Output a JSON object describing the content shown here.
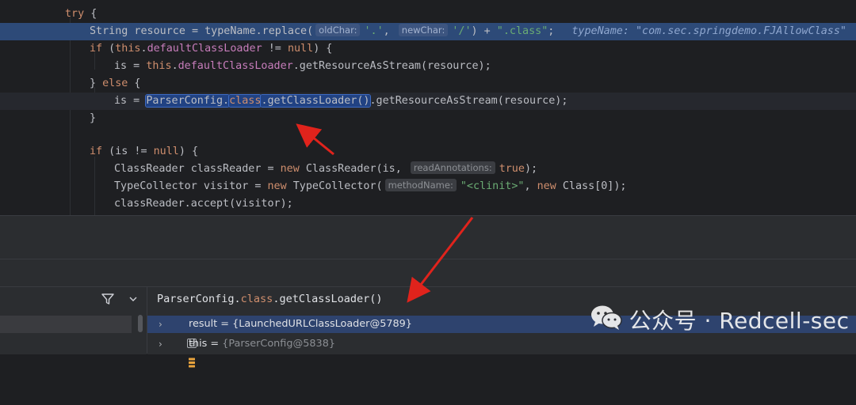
{
  "code_lines": [
    [
      {
        "t": "try",
        "c": "kw"
      },
      {
        "t": " {"
      }
    ],
    [
      {
        "t": "String resource = typeName.replace("
      },
      {
        "hint": "oldChar:"
      },
      {
        "t": "'.'",
        "c": "str"
      },
      {
        "t": ", "
      },
      {
        "hint": "newChar:"
      },
      {
        "t": "'/'",
        "c": "str"
      },
      {
        "t": ") + "
      },
      {
        "t": "\".class\"",
        "c": "str"
      },
      {
        "t": ";"
      },
      {
        "t": "typeName: \"com.sec.springdemo.FJAllowClass\"",
        "c": "inline"
      }
    ],
    [
      {
        "t": "if",
        "c": "kw"
      },
      {
        "t": " ("
      },
      {
        "t": "this",
        "c": "kw"
      },
      {
        "t": "."
      },
      {
        "t": "defaultClassLoader",
        "c": "fld"
      },
      {
        "t": " != "
      },
      {
        "t": "null",
        "c": "kw"
      },
      {
        "t": ") {"
      }
    ],
    [
      {
        "t": "is = "
      },
      {
        "t": "this",
        "c": "kw"
      },
      {
        "t": "."
      },
      {
        "t": "defaultClassLoader",
        "c": "fld"
      },
      {
        "t": ".getResourceAsStream(resource);"
      }
    ],
    [
      {
        "t": "} "
      },
      {
        "t": "else",
        "c": "kw"
      },
      {
        "t": " {"
      }
    ],
    [
      {
        "t": "is = "
      },
      {
        "t": "ParserConfig.",
        "c": "sel"
      },
      {
        "t": "class",
        "c": "sel kw"
      },
      {
        "t": ".getClassLoader()",
        "c": "sel"
      },
      {
        "t": ".getResourceAsStream(resource);"
      }
    ],
    [
      {
        "t": "}"
      }
    ],
    [],
    [
      {
        "t": "if",
        "c": "kw"
      },
      {
        "t": " (is != "
      },
      {
        "t": "null",
        "c": "kw"
      },
      {
        "t": ") {"
      }
    ],
    [
      {
        "t": "ClassReader classReader = "
      },
      {
        "t": "new",
        "c": "kw"
      },
      {
        "t": " ClassReader(is, "
      },
      {
        "hint": "readAnnotations:"
      },
      {
        "t": "true",
        "c": "kw"
      },
      {
        "t": ");"
      }
    ],
    [
      {
        "t": "TypeCollector visitor = "
      },
      {
        "t": "new",
        "c": "kw"
      },
      {
        "t": " TypeCollector("
      },
      {
        "hint": "methodName:"
      },
      {
        "t": "\"<clinit>\"",
        "c": "str"
      },
      {
        "t": ", "
      },
      {
        "t": "new",
        "c": "kw"
      },
      {
        "t": " Class[0]);"
      }
    ],
    [
      {
        "t": "classReader.accept(visitor);"
      }
    ]
  ],
  "evaluator": {
    "expr_prefix": "ParserConfig.",
    "expr_kw": "class",
    "expr_suffix": ".getClassLoader()"
  },
  "variables": [
    {
      "name": "result",
      "eq": " = ",
      "value": "{LaunchedURLClassLoader@5789}",
      "icon": "object-icon",
      "selected": true
    },
    {
      "name": "this",
      "eq": " = ",
      "value": "{ParserConfig@5838}",
      "icon": "field-icon",
      "selected": false
    }
  ],
  "watermark": {
    "text": "公众号 · Redcell-sec",
    "icon": "wechat-icon"
  },
  "colors": {
    "keyword": "#cf8e6d",
    "field": "#c77dbb",
    "string": "#6aab73",
    "execution_line": "#2d4a78",
    "annotation_arrow": "#e0231c"
  }
}
